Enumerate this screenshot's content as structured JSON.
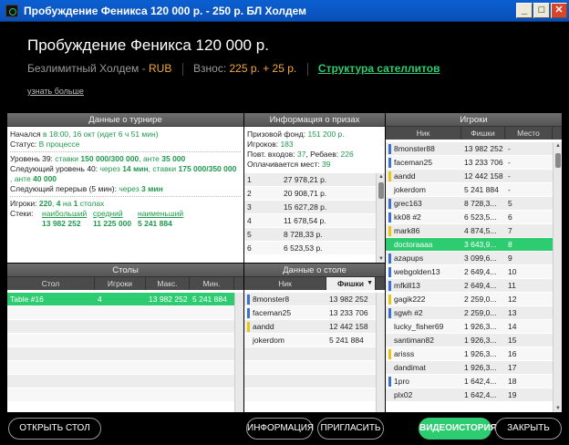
{
  "window": {
    "title": "Пробуждение Феникса 120 000 р. - 250 р. БЛ Холдем",
    "min_label": "_",
    "max_label": "□",
    "close_label": "✕"
  },
  "header": {
    "title": "Пробуждение Феникса 120 000 р.",
    "game": "Безлимитный Холдем",
    "currency_dash": " - ",
    "currency": "RUB",
    "fee_label": "Взнос: ",
    "fee_value": "225 р. + 25 р.",
    "satellite_link": "Структура сателлитов",
    "more_link": "узнать больше"
  },
  "tournament": {
    "header": "Данные о турнире",
    "started_label": "Начался ",
    "started_value": "в 18:00, 16 окт (идет 6 ч 51 мин)",
    "status_label": "Статус: ",
    "status_value": "В процессе",
    "level_label": "Уровень 39: ",
    "level_value": "ставки ",
    "level_blinds": "150 000/300 000",
    "level_ante_label": ", анте ",
    "level_ante": "35 000",
    "next_level_label": "Следующий уровень 40: ",
    "next_level_in": "через ",
    "next_level_time": "14 мин",
    "next_level_stakes": ", ставки ",
    "next_level_blinds": "175 000/350 000",
    "next_level_ante_label": ", анте ",
    "next_level_ante": "40 000",
    "break_label": "Следующий перерыв (5 мин): ",
    "break_in": "через ",
    "break_time": "3 мин",
    "players_label": "Игроки: ",
    "players_value": "220",
    "players_mid": ", ",
    "players_left": "4",
    "players_on": " на ",
    "players_tables": "1",
    "players_tables_label": " столах",
    "stacks_label": "Стеки: ",
    "stack_max_label": "наибольший",
    "stack_avg_label": "средний",
    "stack_min_label": "наименьший",
    "stack_max": "13 982 252",
    "stack_avg": "11 225 000",
    "stack_min": "5 241 884"
  },
  "prizes": {
    "header": "Информация о призах",
    "pool_label": "Призовой фонд: ",
    "pool_value": "151 200 р.",
    "players_label": "Игроков: ",
    "players_value": "183",
    "entries_label": "Повт. входов: ",
    "entries_value": "37",
    "rebuys_label": ", Ребаев: ",
    "rebuys_value": "226",
    "paid_label": "Оплачивается мест: ",
    "paid_value": "39",
    "rows": [
      {
        "place": "1",
        "prize": "27 978,21 р."
      },
      {
        "place": "2",
        "prize": "20 908,71 р."
      },
      {
        "place": "3",
        "prize": "15 627,28 р."
      },
      {
        "place": "4",
        "prize": "11 678,54 р."
      },
      {
        "place": "5",
        "prize": "8 728,33 р."
      },
      {
        "place": "6",
        "prize": "6 523,53 р."
      }
    ]
  },
  "players": {
    "header": "Игроки",
    "col_nick": "Ник",
    "col_chips": "Фишки",
    "col_place": "Место",
    "rows": [
      {
        "mark": "#3b6fd1",
        "nick": "8monster88",
        "chips": "13 982 252",
        "place": "-"
      },
      {
        "mark": "#3b6fd1",
        "nick": "faceman25",
        "chips": "13 233 706",
        "place": "-"
      },
      {
        "mark": "#e6c619",
        "nick": "aandd",
        "chips": "12 442 158",
        "place": "-"
      },
      {
        "mark": "",
        "nick": "jokerdom",
        "chips": "5 241 884",
        "place": "-"
      },
      {
        "mark": "#3b6fd1",
        "nick": "grec163",
        "chips": "8 728,3...",
        "place": "5"
      },
      {
        "mark": "#3b6fd1",
        "nick": "kk08 #2",
        "chips": "6 523,5...",
        "place": "6"
      },
      {
        "mark": "#e6c619",
        "nick": "mark86",
        "chips": "4 874,5...",
        "place": "7"
      },
      {
        "mark": "",
        "nick": "doctoraaaa",
        "chips": "3 643,9...",
        "place": "8",
        "selected": true
      },
      {
        "mark": "#3b6fd1",
        "nick": "azapups",
        "chips": "3 099,6...",
        "place": "9"
      },
      {
        "mark": "#3b6fd1",
        "nick": "webgolden13",
        "chips": "2 649,4...",
        "place": "10"
      },
      {
        "mark": "#3b6fd1",
        "nick": "mfkill13",
        "chips": "2 649,4...",
        "place": "11"
      },
      {
        "mark": "#e6c619",
        "nick": "gagik222",
        "chips": "2 259,0...",
        "place": "12"
      },
      {
        "mark": "#3b6fd1",
        "nick": "sgwh #2",
        "chips": "2 259,0...",
        "place": "13"
      },
      {
        "mark": "",
        "nick": "lucky_fisher69",
        "chips": "1 926,3...",
        "place": "14"
      },
      {
        "mark": "",
        "nick": "santiman82",
        "chips": "1 926,3...",
        "place": "15"
      },
      {
        "mark": "#e6c619",
        "nick": "arisss",
        "chips": "1 926,3...",
        "place": "16"
      },
      {
        "mark": "",
        "nick": "dandimat",
        "chips": "1 926,3...",
        "place": "17"
      },
      {
        "mark": "#3b6fd1",
        "nick": "1pro",
        "chips": "1 642,4...",
        "place": "18"
      },
      {
        "mark": "",
        "nick": "plx02",
        "chips": "1 642,4...",
        "place": "19"
      }
    ]
  },
  "tables": {
    "header": "Столы",
    "col_table": "Стол",
    "col_players": "Игроки",
    "col_max": "Макс.",
    "col_min": "Мин.",
    "rows": [
      {
        "table": "Table #16",
        "players": "4",
        "max": "13 982 252",
        "min": "5 241 884"
      }
    ]
  },
  "table_info": {
    "header": "Данные о столе",
    "col_nick": "Ник",
    "col_chips": "Фишки",
    "sort_icon": "▼",
    "rows": [
      {
        "mark": "#3b6fd1",
        "nick": "8monster8",
        "chips": "13 982 252"
      },
      {
        "mark": "#3b6fd1",
        "nick": "faceman25",
        "chips": "13 233 706"
      },
      {
        "mark": "#e6c619",
        "nick": "aandd",
        "chips": "12 442 158"
      },
      {
        "mark": "",
        "nick": "jokerdom",
        "chips": "5 241 884"
      }
    ]
  },
  "buttons": {
    "open_table": "ОТКРЫТЬ СТОЛ",
    "info": "ИНФОРМАЦИЯ",
    "invite": "ПРИГЛАСИТЬ",
    "video": "ВИДЕОИСТОРИЯ",
    "close": "ЗАКРЫТЬ"
  }
}
